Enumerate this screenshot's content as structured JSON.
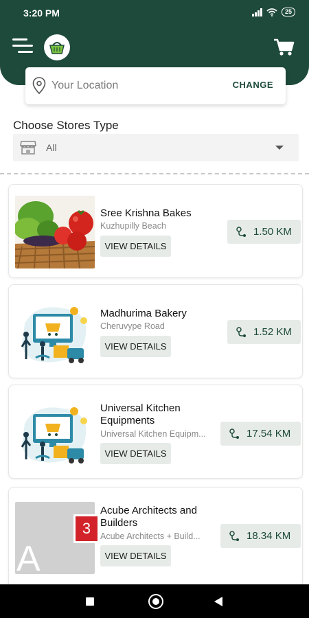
{
  "status_bar": {
    "time": "3:20 PM",
    "battery": "25"
  },
  "header": {
    "logo_icon": "basket-logo-icon",
    "menu_icon": "menu-icon",
    "cart_icon": "cart-icon"
  },
  "location": {
    "placeholder": "Your Location",
    "change_label": "CHANGE"
  },
  "filter": {
    "title": "Choose Stores Type",
    "selected": "All"
  },
  "stores": [
    {
      "name": "Sree Krishna Bakes",
      "address": "Kuzhupilly Beach",
      "button": "VIEW DETAILS",
      "distance": "1.50 KM",
      "image": "vegetables-photo"
    },
    {
      "name": "Madhurima Bakery",
      "address": "Cheruvype Road",
      "button": "VIEW DETAILS",
      "distance": "1.52 KM",
      "image": "delivery-illustration"
    },
    {
      "name": "Universal Kitchen Equipments",
      "address": "Universal Kitchen Equipm...",
      "button": "VIEW DETAILS",
      "distance": "17.54 KM",
      "image": "delivery-illustration"
    },
    {
      "name": "Acube Architects and Builders",
      "address": "Acube Architects + Build...",
      "button": "VIEW DETAILS",
      "distance": "18.34 KM",
      "image": "placeholder-letter",
      "badge": "3",
      "letter": "A"
    }
  ],
  "colors": {
    "brand": "#1d4a3a",
    "chip": "#e6ebe8",
    "badge": "#d2232a"
  }
}
